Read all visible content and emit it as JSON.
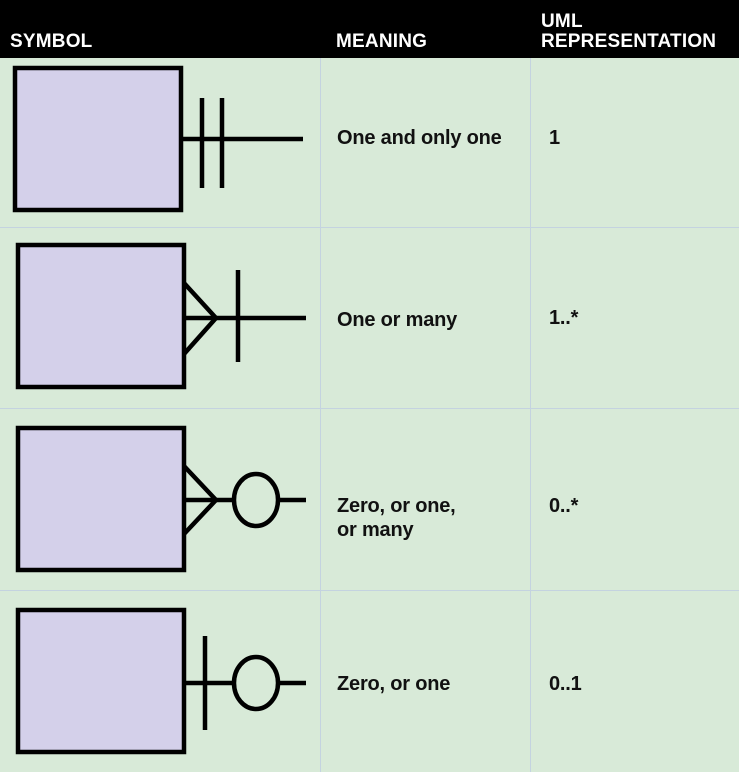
{
  "header": {
    "symbol": "SYMBOL",
    "meaning": "MEANING",
    "uml_line1": "UML",
    "uml_line2": "REPRESENTATION"
  },
  "rows": [
    {
      "symbol": "one-and-only-one-symbol",
      "meaning": "One and only one",
      "uml": "1"
    },
    {
      "symbol": "one-or-many-symbol",
      "meaning": "One or many",
      "uml": "1..*"
    },
    {
      "symbol": "zero-one-or-many-symbol",
      "meaning_line1": "Zero, or one,",
      "meaning_line2": "or many",
      "uml": "0..*"
    },
    {
      "symbol": "zero-or-one-symbol",
      "meaning": "Zero, or one",
      "uml": "0..1"
    }
  ],
  "colors": {
    "background": "#d8ead8",
    "header": "#000000",
    "entity_fill": "#d4d0ea",
    "grid": "#c4d3e0"
  }
}
